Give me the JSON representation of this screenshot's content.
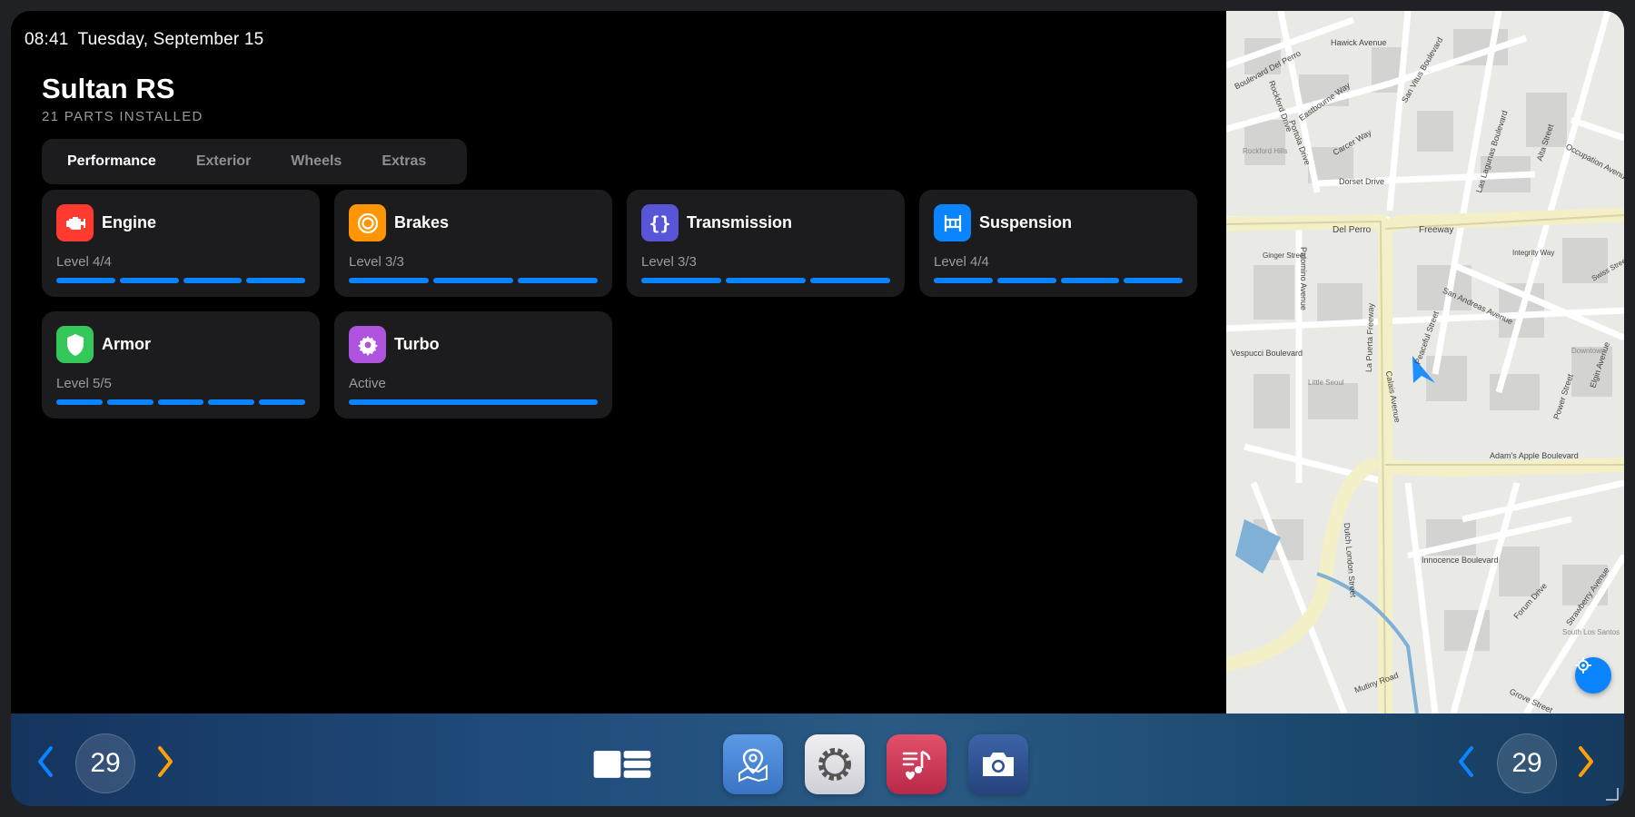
{
  "status_bar": {
    "time": "08:41",
    "date": "Tuesday, September 15"
  },
  "vehicle": {
    "name": "Sultan RS",
    "parts_installed": "21 PARTS INSTALLED"
  },
  "tabs": [
    {
      "label": "Performance",
      "active": true
    },
    {
      "label": "Exterior",
      "active": false
    },
    {
      "label": "Wheels",
      "active": false
    },
    {
      "label": "Extras",
      "active": false
    }
  ],
  "parts": [
    {
      "name": "Engine",
      "status": "Level 4/4",
      "level": 4,
      "max": 4,
      "icon": "engine-icon",
      "color": "#ff3b30"
    },
    {
      "name": "Brakes",
      "status": "Level 3/3",
      "level": 3,
      "max": 3,
      "icon": "brake-disc-icon",
      "color": "#ff9500"
    },
    {
      "name": "Transmission",
      "status": "Level 3/3",
      "level": 3,
      "max": 3,
      "icon": "braces-icon",
      "color": "#5856d6"
    },
    {
      "name": "Suspension",
      "status": "Level 4/4",
      "level": 4,
      "max": 4,
      "icon": "suspension-icon",
      "color": "#0a84ff"
    },
    {
      "name": "Armor",
      "status": "Level 5/5",
      "level": 5,
      "max": 5,
      "icon": "shield-icon",
      "color": "#34c759"
    },
    {
      "name": "Turbo",
      "status": "Active",
      "level": 1,
      "max": 1,
      "icon": "turbo-gear-icon",
      "color": "#af52de"
    }
  ],
  "map": {
    "street_labels": [
      "Hawick Avenue",
      "Boulevard Del Perro",
      "Rockford Drive",
      "Eastbourne Way",
      "San Vitus Boulevard",
      "Carcer Way",
      "Portola Drive",
      "Dorset Drive",
      "Las Lagunas Boulevard",
      "Alta Street",
      "Occupation Avenue",
      "Del Perro",
      "Freeway",
      "Ginger Street",
      "Integrity Way",
      "Swiss Street",
      "San Andreas Avenue",
      "Vespucci Boulevard",
      "Palomino Avenue",
      "La Puerta Freeway",
      "Peaceful Street",
      "Power Street",
      "Elgin Avenue",
      "Adam's Apple Boulevard",
      "Innocence Boulevard",
      "Forum Drive",
      "Strawberry Avenue",
      "Dutch London Street",
      "Calais Avenue",
      "Mutiny Road",
      "Grove Street",
      "Rockford Hills",
      "Little Seoul",
      "Downtown",
      "South Los Santos"
    ]
  },
  "dock": {
    "left_counter": "29",
    "right_counter": "29",
    "accent_prev": "#0a84ff",
    "accent_next": "#ff9f0a",
    "apps": [
      {
        "name": "layout-icon"
      },
      {
        "name": "maps-icon",
        "color": "#3f7fd0"
      },
      {
        "name": "settings-icon",
        "color": "#e6e6ea"
      },
      {
        "name": "music-icon",
        "color": "#d23a55"
      },
      {
        "name": "camera-icon",
        "color": "#2f4f8f"
      }
    ]
  }
}
